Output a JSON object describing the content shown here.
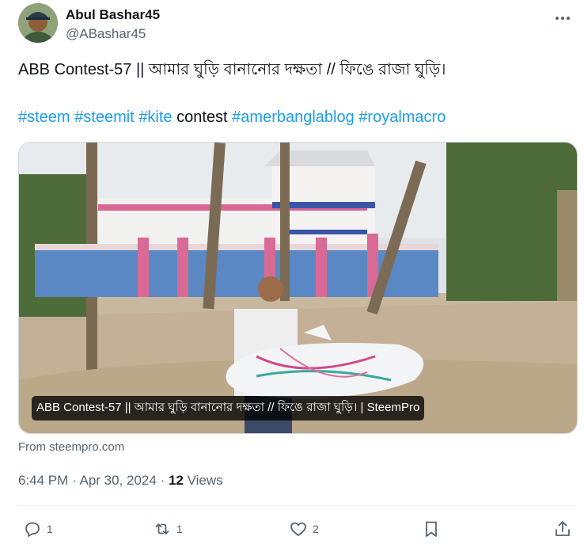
{
  "author": {
    "name": "Abul Bashar45",
    "handle": "@ABashar45"
  },
  "post": {
    "title_line": "ABB Contest-57 || আমার ঘুড়ি বানানোর দক্ষতা // ফিঙে রাজা ঘুড়ি।",
    "tags": {
      "t1": "#steem",
      "t2": "#steemit",
      "t3": "#kite",
      "plain": "contest",
      "t4": "#amerbanglablog",
      "t5": "#royalmacro"
    }
  },
  "media": {
    "caption": "ABB Contest-57 || আমার ঘুড়ি বানানোর দক্ষতা // ফিঙে রাজা ঘুড়ি। | SteemPro",
    "source": "From steempro.com"
  },
  "meta": {
    "time": "6:44 PM",
    "sep1": " · ",
    "date": "Apr 30, 2024",
    "sep2": " · ",
    "views_count": "12",
    "views_label": " Views"
  },
  "actions": {
    "reply_count": "1",
    "retweet_count": "1",
    "like_count": "2"
  },
  "colors": {
    "link": "#1d9bf0",
    "secondary": "#536471",
    "primary": "#0f1419"
  },
  "icons": [
    "more-icon",
    "reply-icon",
    "retweet-icon",
    "like-icon",
    "bookmark-icon",
    "share-icon"
  ]
}
